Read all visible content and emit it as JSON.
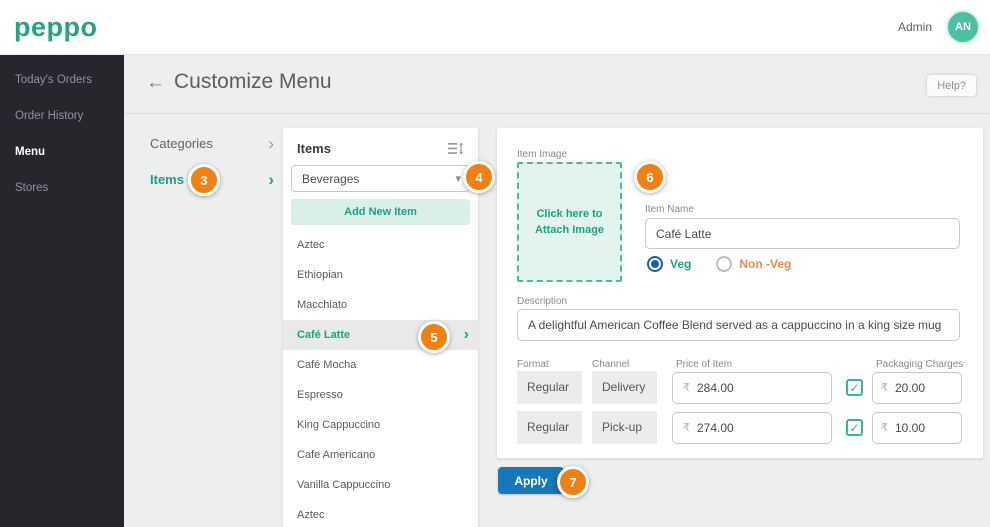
{
  "brand": {
    "logo": "peppo",
    "accent_teal": "#1fa183"
  },
  "header": {
    "admin_label": "Admin",
    "avatar_initials": "AN"
  },
  "sidebar": {
    "items": [
      {
        "label": "Today's Orders",
        "active": false
      },
      {
        "label": "Order History",
        "active": false
      },
      {
        "label": "Menu",
        "active": true
      },
      {
        "label": "Stores",
        "active": false
      }
    ]
  },
  "titlebar": {
    "title": "Customize Menu",
    "help_label": "Help?"
  },
  "nav_panel": {
    "categories_label": "Categories",
    "items_label": "Items"
  },
  "items_panel": {
    "header": "Items",
    "category_select_value": "Beverages",
    "add_button_label": "Add New Item",
    "items": [
      "Aztec",
      "Ethiopian",
      "Macchiato",
      "Café Latte",
      "Café Mocha",
      "Espresso",
      "King Cappuccino",
      "Cafe Americano",
      "Vanilla Cappuccino",
      "Aztec"
    ],
    "selected_item": "Café Latte"
  },
  "detail_panel": {
    "item_image_label": "Item Image",
    "attach_text": "Click here to Attach Image",
    "item_name_label": "Item Name",
    "item_name_value": "Café Latte",
    "veg_label": "Veg",
    "nonveg_label": "Non -Veg",
    "veg_selected": true,
    "description_label": "Description",
    "description_value": "A delightful American Coffee Blend served as a cappuccino in a king size mug",
    "pricing": {
      "headers": {
        "format": "Format",
        "channel": "Channel",
        "price": "Price of Item",
        "packaging": "Packaging Charges"
      },
      "rows": [
        {
          "format": "Regular",
          "channel": "Delivery",
          "currency": "₹",
          "price": "284.00",
          "packaging_checked": true,
          "packaging": "20.00"
        },
        {
          "format": "Regular",
          "channel": "Pick-up",
          "currency": "₹",
          "price": "274.00",
          "packaging_checked": true,
          "packaging": "10.00"
        }
      ]
    },
    "apply_label": "Apply"
  },
  "tour_badges": [
    "3",
    "4",
    "5",
    "6",
    "7"
  ],
  "icons": {
    "back": "←",
    "caret_down": "▾",
    "chevron_right": "›",
    "check": "✓"
  },
  "colors": {
    "badge_orange": "#ef8113",
    "apply_blue": "#1478bd",
    "veg_radio_blue": "#1360b5",
    "nonveg_orange": "#f08a4a"
  }
}
